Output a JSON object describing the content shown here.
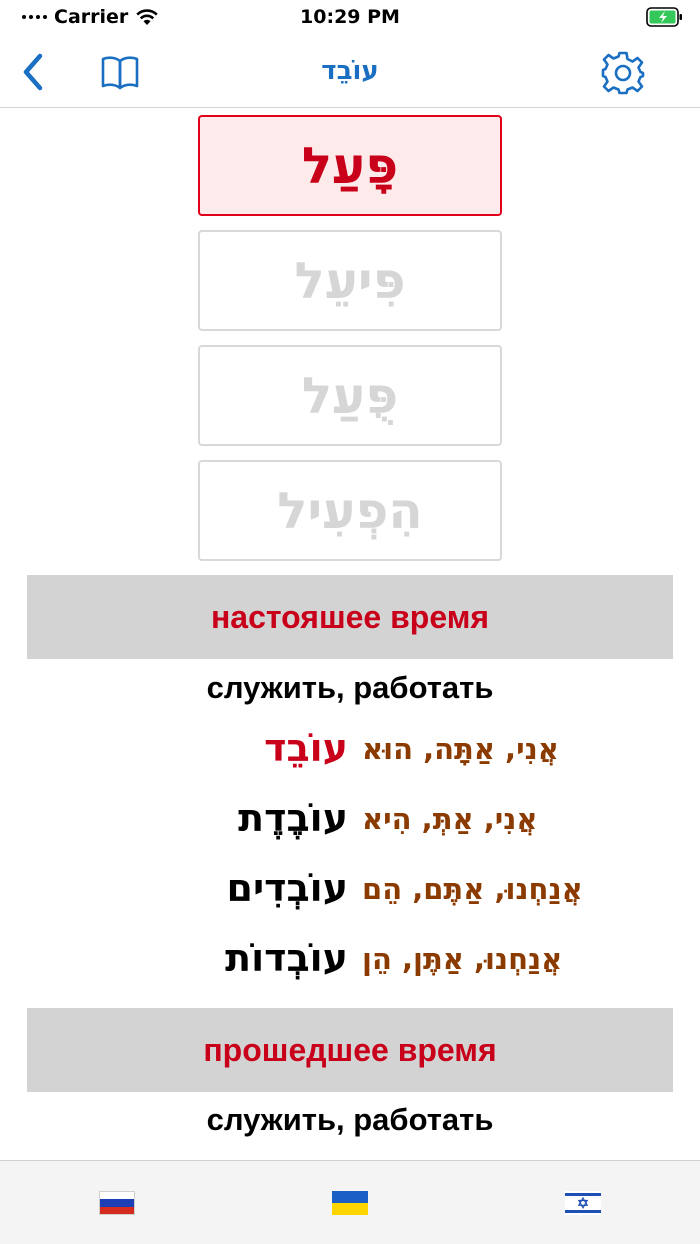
{
  "status_bar": {
    "carrier": "Carrier",
    "time": "10:29 PM"
  },
  "nav": {
    "title": "עוֹבֵד",
    "back_icon": "chevron-left-icon",
    "book_icon": "book-icon",
    "settings_icon": "gear-icon",
    "accent_color": "#1a6fc2"
  },
  "binyanim": [
    {
      "label": "פָּעַל",
      "active": true
    },
    {
      "label": "פִּיעֵל",
      "active": false
    },
    {
      "label": "פֻּעַל",
      "active": false
    },
    {
      "label": "הִפְעִיל",
      "active": false
    }
  ],
  "present": {
    "header": "настояшее время",
    "meaning": "служить, работать",
    "rows": [
      {
        "form": "עוֹבֵד",
        "pronouns": "אֲנִי, אַתָּה, הוּא"
      },
      {
        "form": "עוֹבֶדֶת",
        "pronouns": "אֲנִי, אַתְּ, הִיא"
      },
      {
        "form": "עוֹבְדִים",
        "pronouns": "אֲנַחְנוּ, אַתֶּם, הֵם"
      },
      {
        "form": "עוֹבְדוֹת",
        "pronouns": "אֲנַחְנוּ, אַתֶּן, הֵן"
      }
    ]
  },
  "past": {
    "header": "прошедшее время",
    "meaning": "служить, работать"
  },
  "tabs": [
    {
      "icon": "russia-flag-icon"
    },
    {
      "icon": "ukraine-flag-icon"
    },
    {
      "icon": "israel-flag-icon"
    }
  ],
  "colors": {
    "header_red": "#c8001a",
    "pronoun_brown": "#8b3a00",
    "header_bg": "#d3d3d3"
  }
}
